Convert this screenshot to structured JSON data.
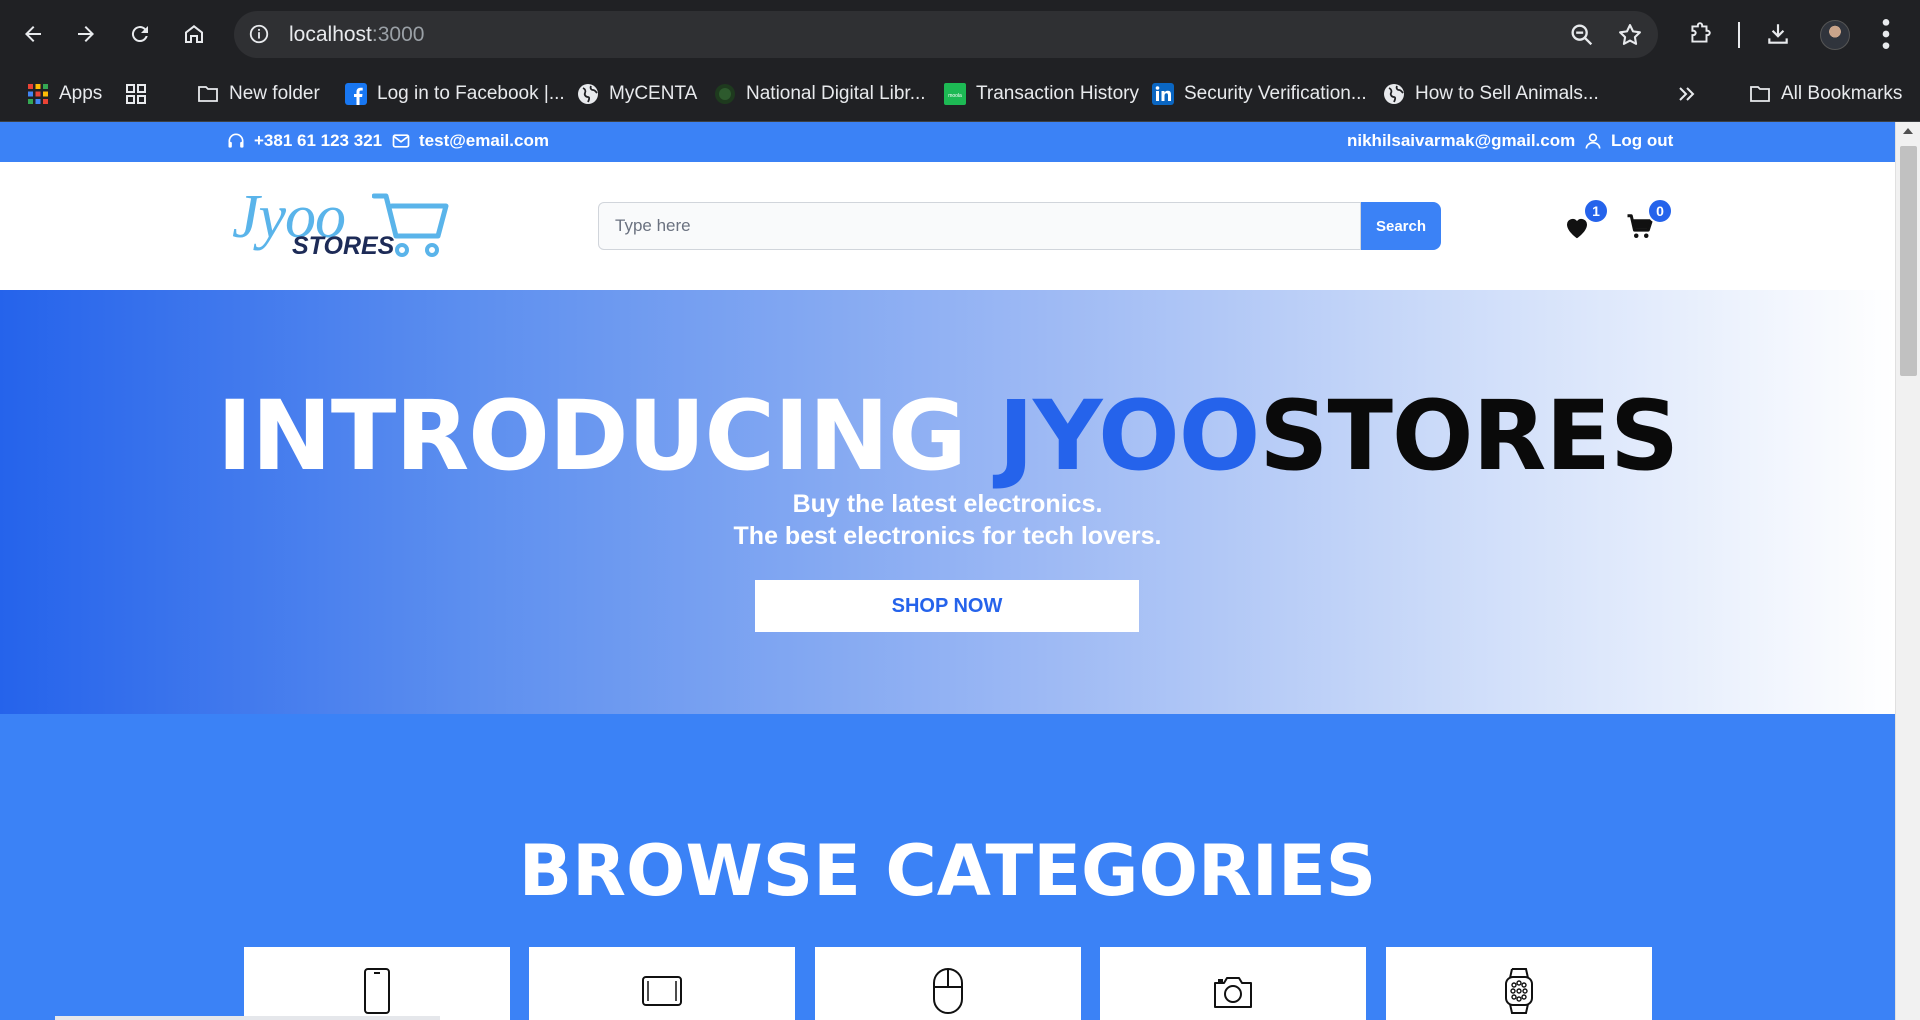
{
  "browser": {
    "url_host": "localhost",
    "url_port": ":3000"
  },
  "bookmarks": [
    {
      "label": "Apps",
      "icon": "apps-grid-icon"
    },
    {
      "label": "",
      "icon": "tab-groups-icon"
    },
    {
      "label": "New folder",
      "icon": "folder-icon"
    },
    {
      "label": "Log in to Facebook |...",
      "icon": "facebook-icon"
    },
    {
      "label": "MyCENTA",
      "icon": "globe-icon"
    },
    {
      "label": "National Digital Libr...",
      "icon": "ndl-icon"
    },
    {
      "label": "Transaction History",
      "icon": "moola-icon"
    },
    {
      "label": "Security Verification...",
      "icon": "linkedin-icon"
    },
    {
      "label": "How to Sell Animals...",
      "icon": "globe-icon"
    },
    {
      "label": "All Bookmarks",
      "icon": "folder-icon"
    }
  ],
  "topbar": {
    "phone": "+381 61 123 321",
    "email": "test@email.com",
    "user_email": "nikhilsaivarmak@gmail.com",
    "logout": "Log out"
  },
  "header": {
    "logo_script": "Jyoo",
    "logo_stores": "STORES",
    "search_placeholder": "Type here",
    "search_button": "Search",
    "wishlist_count": "1",
    "cart_count": "0"
  },
  "hero": {
    "title_part1": "INTRODUCING ",
    "title_part2": "JYOO",
    "title_part3": "STORES",
    "subtitle_line1": "Buy the latest electronics.",
    "subtitle_line2": "The best electronics for tech lovers.",
    "cta": "SHOP NOW"
  },
  "categories": {
    "title": "BROWSE CATEGORIES",
    "items": [
      {
        "icon": "smartphone-icon"
      },
      {
        "icon": "tablet-icon"
      },
      {
        "icon": "mouse-icon"
      },
      {
        "icon": "camera-icon"
      },
      {
        "icon": "smartwatch-icon"
      }
    ]
  },
  "colors": {
    "brand_blue": "#3b82f6",
    "accent_blue": "#2563eb",
    "logo_light_blue": "#5ab4ea",
    "logo_navy": "#1d2b57"
  }
}
